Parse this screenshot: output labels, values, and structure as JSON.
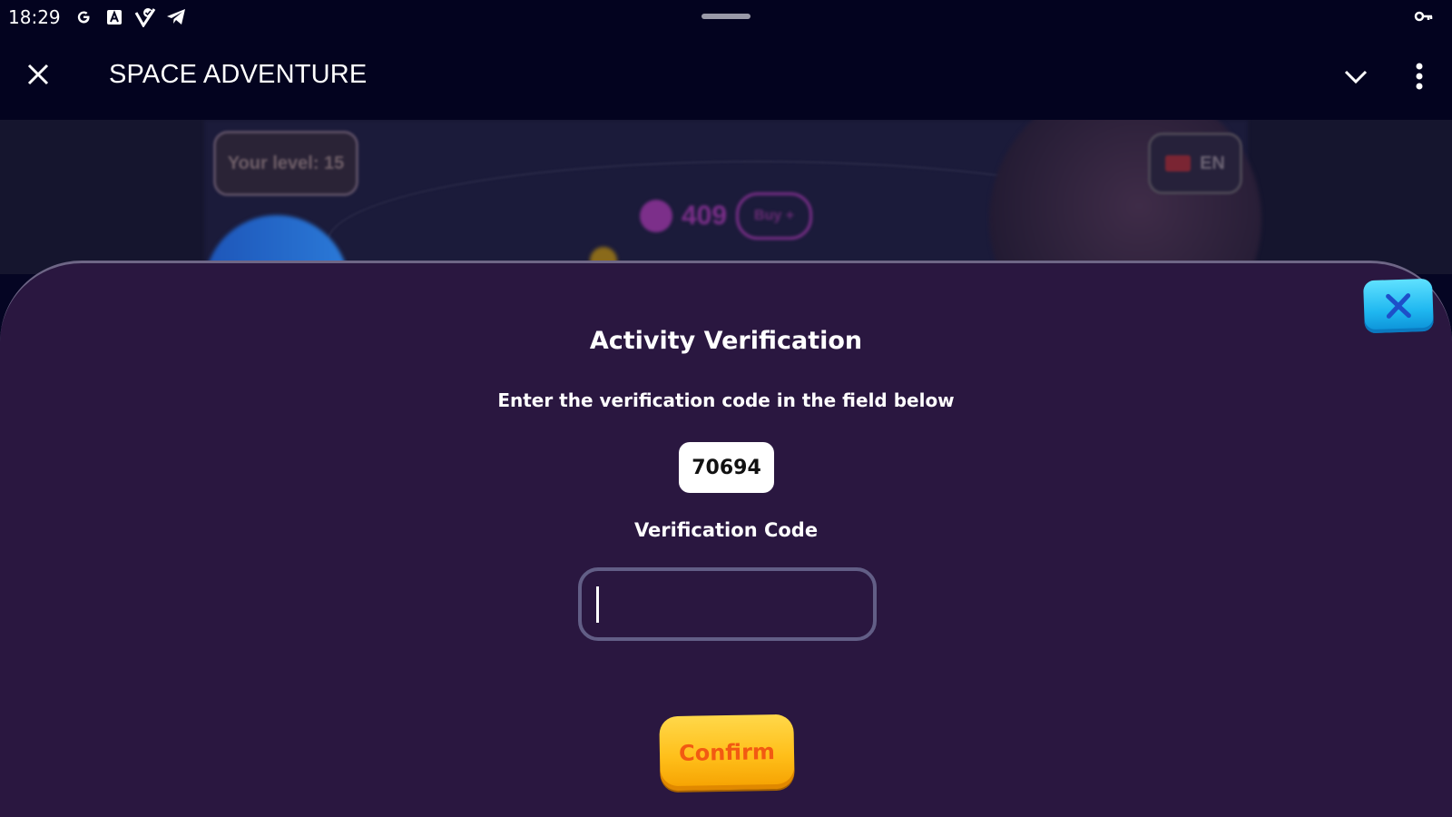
{
  "status_bar": {
    "time": "18:29",
    "icons": [
      "google-icon",
      "translate-icon",
      "shield-check-icon",
      "telegram-icon"
    ],
    "right_icon": "key-icon"
  },
  "app_bar": {
    "title": "SPACE ADVENTURE",
    "close_icon": "close-icon",
    "collapse_icon": "chevron-down-icon",
    "menu_icon": "more-vert-icon"
  },
  "background_game": {
    "level_label": "Your level: 15",
    "language": "EN",
    "coins": "409",
    "buy_label": "Buy +"
  },
  "modal": {
    "title": "Activity Verification",
    "instruction": "Enter the verification code in the field below",
    "code": "70694",
    "input_label": "Verification Code",
    "input_value": "",
    "confirm_label": "Confirm",
    "close_icon": "close-icon"
  },
  "colors": {
    "app_bar_bg": "#03031f",
    "sheet_bg": "#2a1740",
    "confirm_text": "#f25a12",
    "confirm_bg": "#ffc52a",
    "close_button_bg": "#1fb7f0"
  }
}
